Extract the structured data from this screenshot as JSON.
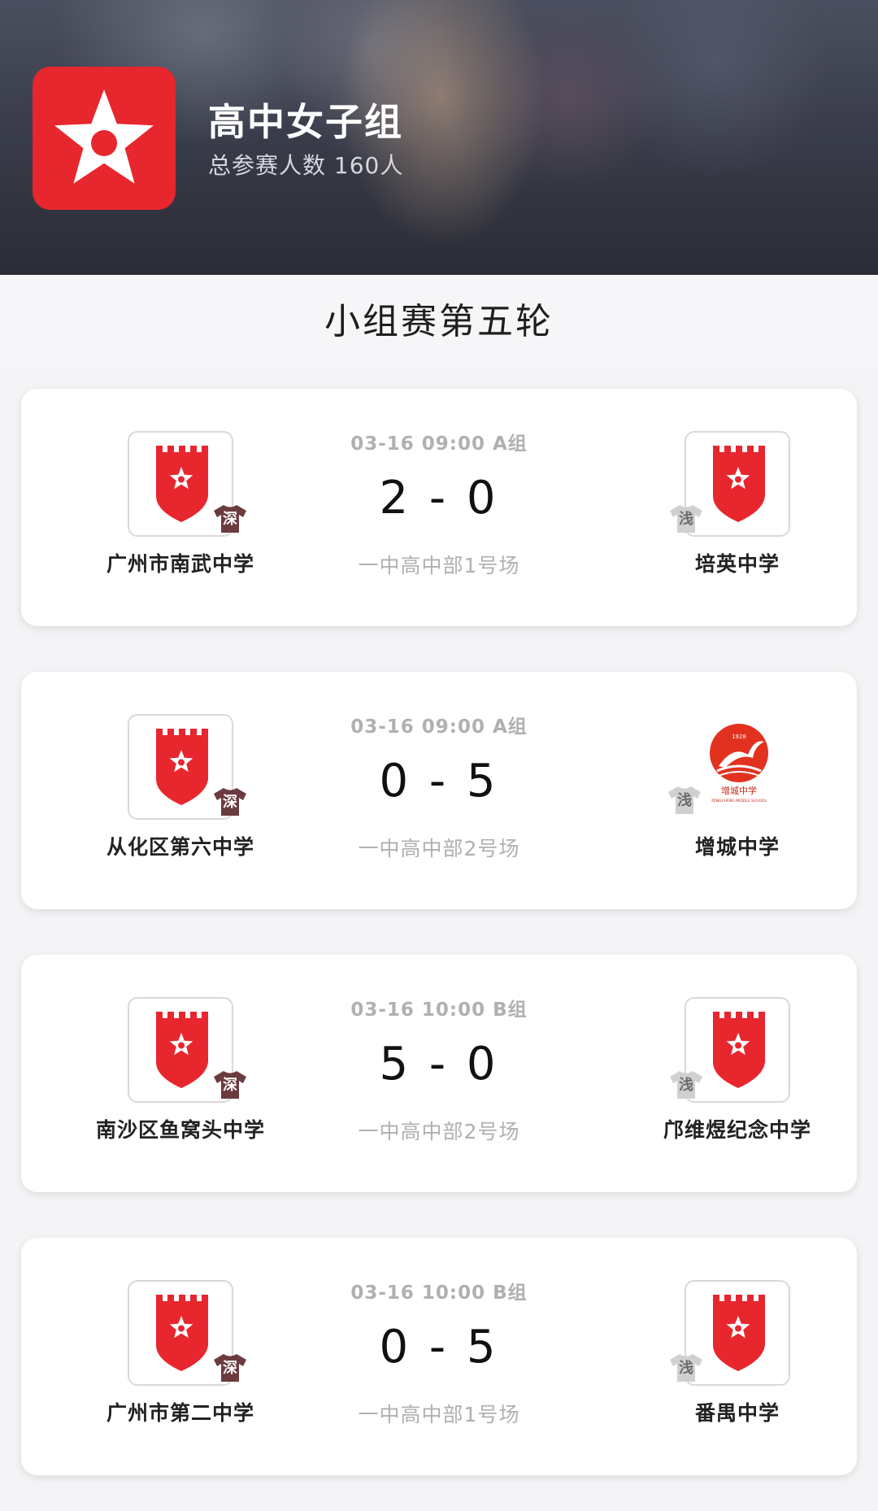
{
  "header": {
    "title": "高中女子组",
    "subtitle": "总参赛人数 160人",
    "logo_icon": "red-star-logo"
  },
  "round": {
    "title": "小组赛第五轮"
  },
  "colors": {
    "brand_red": "#e8262e",
    "home_jersey": "#6b3b3e",
    "away_jersey": "#d0d0d0"
  },
  "matches": [
    {
      "datetime": "03-16 09:00",
      "group": "A组",
      "score": "2 - 0",
      "venue": "一中高中部1号场",
      "home": {
        "name": "广州市南武中学",
        "jersey": "深",
        "badge": "red-shield-star"
      },
      "away": {
        "name": "培英中学",
        "jersey": "浅",
        "badge": "red-shield-star"
      }
    },
    {
      "datetime": "03-16 09:00",
      "group": "A组",
      "score": "0 - 5",
      "venue": "一中高中部2号场",
      "home": {
        "name": "从化区第六中学",
        "jersey": "深",
        "badge": "red-shield-star"
      },
      "away": {
        "name": "增城中学",
        "jersey": "浅",
        "badge": "zengcheng-school-logo",
        "logo_year": "1928",
        "logo_text": "增城中学",
        "logo_en": "ZENGCHENG MIDDLE SCHOOL"
      }
    },
    {
      "datetime": "03-16 10:00",
      "group": "B组",
      "score": "5 - 0",
      "venue": "一中高中部2号场",
      "home": {
        "name": "南沙区鱼窝头中学",
        "jersey": "深",
        "badge": "red-shield-star"
      },
      "away": {
        "name": "邝维煜纪念中学",
        "jersey": "浅",
        "badge": "red-shield-star"
      }
    },
    {
      "datetime": "03-16 10:00",
      "group": "B组",
      "score": "0 - 5",
      "venue": "一中高中部1号场",
      "home": {
        "name": "广州市第二中学",
        "jersey": "深",
        "badge": "red-shield-star"
      },
      "away": {
        "name": "番禺中学",
        "jersey": "浅",
        "badge": "red-shield-star"
      }
    }
  ]
}
